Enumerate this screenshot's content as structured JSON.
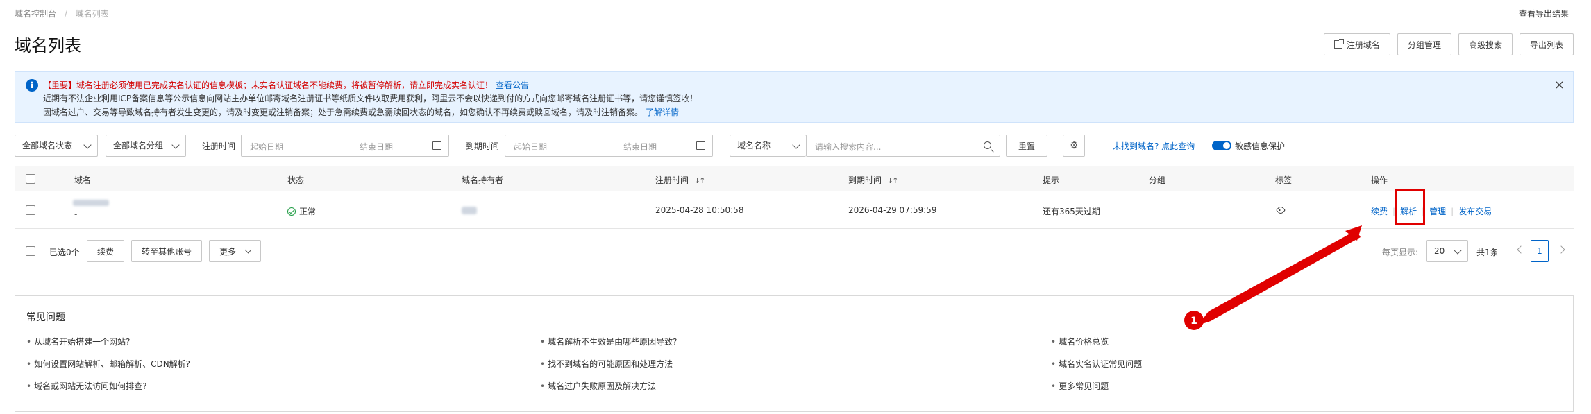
{
  "breadcrumb": {
    "root": "域名控制台",
    "separator": "/",
    "current": "域名列表"
  },
  "export_results_link": "查看导出结果",
  "page_title": "域名列表",
  "header_actions": {
    "register": "注册域名",
    "group_manage": "分组管理",
    "advanced_search": "高级搜索",
    "export": "导出列表"
  },
  "notice": {
    "line1_prefix": "【重要】域名注册必须使用已完成实名认证的信息模板；未实名认证域名不能续费，将被暂停解析，请立即完成实名认证！",
    "line1_link": "查看公告",
    "line2": "近期有不法企业利用ICP备案信息等公示信息向网站主办单位邮寄域名注册证书等纸质文件收取费用获利，阿里云不会以快递到付的方式向您邮寄域名注册证书等，请您谨慎签收！",
    "line3_prefix": "因域名过户、交易等导致域名持有者发生变更的，请及时变更或注销备案；处于急需续费或急需赎回状态的域名，如您确认不再续费或赎回域名，请及时注销备案。",
    "line3_link": "了解详情",
    "close_glyph": "×"
  },
  "filters": {
    "status_select": "全部域名状态",
    "group_select": "全部域名分组",
    "reg_time_label": "注册时间",
    "reg_start_placeholder": "起始日期",
    "reg_end_placeholder": "结束日期",
    "range_sep": "-",
    "exp_time_label": "到期时间",
    "exp_start_placeholder": "起始日期",
    "exp_end_placeholder": "结束日期",
    "field_select": "域名名称",
    "search_placeholder": "请输入搜索内容...",
    "reset": "重置",
    "settings_glyph": "⚙",
    "not_found_link": "未找到域名? 点此查询",
    "privacy_toggle_label": "敏感信息保护",
    "privacy_toggle_on": true
  },
  "table": {
    "columns": {
      "domain": "域名",
      "status": "状态",
      "holder": "域名持有者",
      "reg_time": "注册时间",
      "exp_time": "到期时间",
      "hint": "提示",
      "group": "分组",
      "tag": "标签",
      "ops": "操作"
    },
    "sort_glyph": "↓↑",
    "rows": [
      {
        "domain_sub": "-",
        "status": "正常",
        "reg_time": "2025-04-28 10:50:58",
        "exp_time": "2026-04-29 07:59:59",
        "hint": "还有365天过期",
        "group": "",
        "ops": {
          "renew": "续费",
          "dns": "解析",
          "manage": "管理",
          "publish": "发布交易"
        }
      }
    ]
  },
  "bulk": {
    "selected_label": "已选0个",
    "renew": "续费",
    "transfer": "转至其他账号",
    "more": "更多",
    "per_page_label": "每页显示:",
    "per_page_value": "20",
    "total": "共1条",
    "current_page": "1"
  },
  "faq": {
    "title": "常见问题",
    "col1": [
      "从域名开始搭建一个网站?",
      "如何设置网站解析、邮箱解析、CDN解析?",
      "域名或网站无法访问如何排查?"
    ],
    "col2": [
      "域名解析不生效是由哪些原因导致?",
      "找不到域名的可能原因和处理方法",
      "域名过户失败原因及解决方法"
    ],
    "col3": [
      "域名价格总览",
      "域名实名认证常见问题",
      "更多常见问题"
    ]
  },
  "annotation": {
    "marker_label": "1",
    "color": "#e00000"
  },
  "colors": {
    "accent": "#0064c8",
    "notice_bg": "#e8f3ff",
    "success": "#1e9c43",
    "warning_text": "#d40000"
  }
}
